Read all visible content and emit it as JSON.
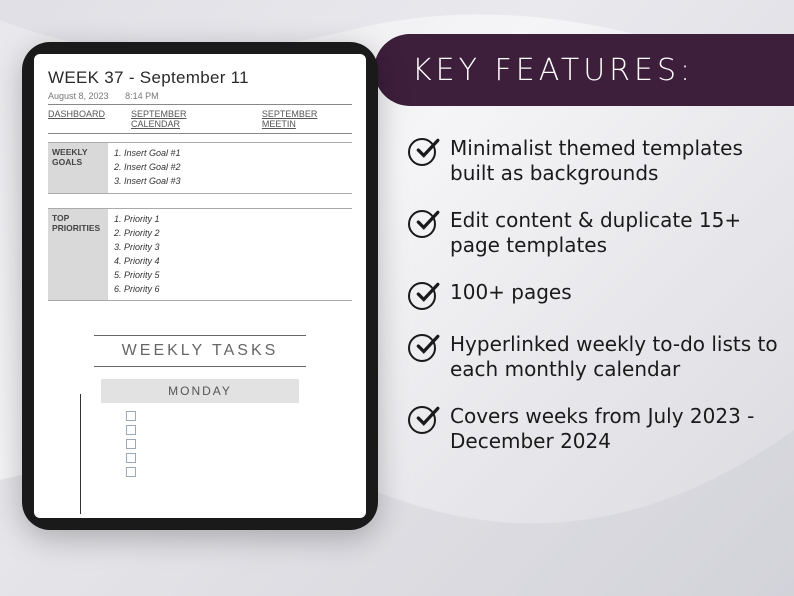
{
  "banner": {
    "title": "KEY FEATURES:"
  },
  "planner": {
    "week_title": "WEEK 37 - September 11",
    "stamp_date": "August 8, 2023",
    "stamp_time": "8:14 PM",
    "nav": {
      "dashboard": "DASHBOARD",
      "calendar": "SEPTEMBER CALENDAR",
      "meetings": "SEPTEMBER MEETIN"
    },
    "goals_label": "WEEKLY GOALS",
    "goals": {
      "g1": "1. Insert Goal #1",
      "g2": "2. Insert Goal #2",
      "g3": "3. Insert Goal #3"
    },
    "priorities_label": "TOP PRIORITIES",
    "priorities": {
      "p1": "1. Priority 1",
      "p2": "2. Priority 2",
      "p3": "3. Priority 3",
      "p4": "4. Priority 4",
      "p5": "5. Priority 5",
      "p6": "6. Priority 6"
    },
    "weekly_tasks_label": "WEEKLY TASKS",
    "day_label": "MONDAY"
  },
  "features": {
    "f1": "Minimalist themed templates built as backgrounds",
    "f2": "Edit content & duplicate 15+ page templates",
    "f3": "100+ pages",
    "f4": "Hyperlinked weekly to-do lists to each monthly calendar",
    "f5": "Covers weeks from July 2023 - December 2024"
  }
}
